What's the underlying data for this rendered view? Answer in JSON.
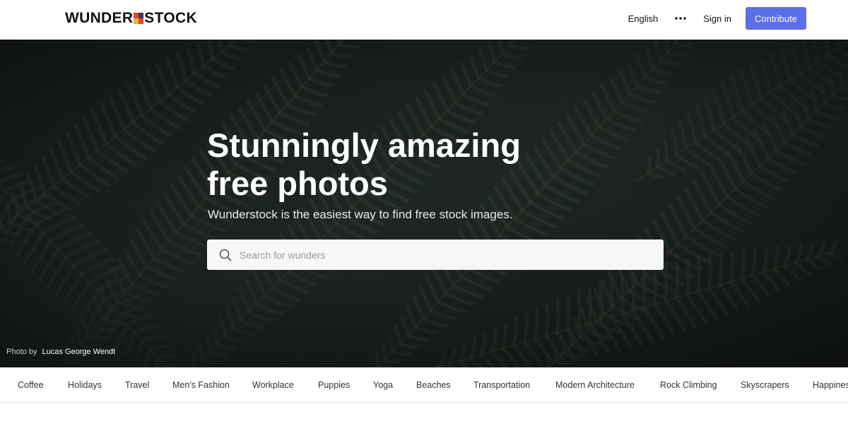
{
  "header": {
    "logo_text_left": "WUNDER",
    "logo_text_right": "STOCK",
    "language": "English",
    "more_icon": "more-dots-icon",
    "sign_in": "Sign in",
    "contribute": "Contribute",
    "contribute_color": "#5b6fe8"
  },
  "hero": {
    "title_line1": "Stunningly amazing",
    "title_line2": "free photos",
    "subtitle": "Wunderstock is the easiest way to find free stock images.",
    "search_placeholder": "Search for wunders",
    "search_icon": "search-icon",
    "credit_prefix": "Photo by",
    "credit_name": "Lucas George Wendt"
  },
  "categories": [
    "Coffee",
    "Holidays",
    "Travel",
    "Men's Fashion",
    "Workplace",
    "Puppies",
    "Yoga",
    "Beaches",
    "Transportation",
    "Modern Architecture",
    "Rock Climbing",
    "Skyscrapers",
    "Happines"
  ]
}
